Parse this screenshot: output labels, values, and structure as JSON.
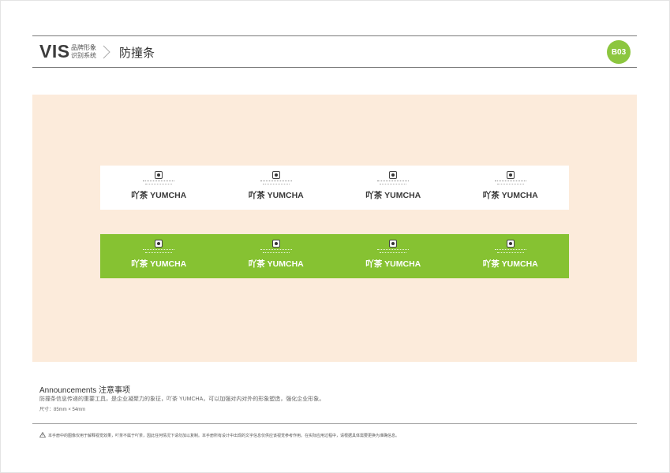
{
  "header": {
    "vis": "VIS",
    "vis_sub_line1": "品牌形象",
    "vis_sub_line2": "识别系统",
    "title": "防撞条",
    "badge": "B03"
  },
  "strips": {
    "white": {
      "background": "#ffffff",
      "logos": [
        {
          "wordmark": "吖茶 YUMCHA"
        },
        {
          "wordmark": "吖茶 YUMCHA"
        },
        {
          "wordmark": "吖茶 YUMCHA"
        },
        {
          "wordmark": "吖茶 YUMCHA"
        }
      ]
    },
    "green": {
      "background": "#86c232",
      "logos": [
        {
          "wordmark": "吖茶 YUMCHA"
        },
        {
          "wordmark": "吖茶 YUMCHA"
        },
        {
          "wordmark": "吖茶 YUMCHA"
        },
        {
          "wordmark": "吖茶 YUMCHA"
        }
      ]
    }
  },
  "announcements": {
    "title": "Announcements  注意事项",
    "body": "防撞条信息传递的重要工具，是企业凝聚力的象征，吖茶 YUMCHA，可以加强对内对外的形象塑造，强化企业形象。",
    "size": "尺寸：85mm × 54mm"
  },
  "footer": {
    "icon": "warning-icon",
    "text": "本手册中的图像仅用于解释视觉效果，吖茶不属于吖茶，因此任何情况下请勿加以复制。本手册所有设计中出现的文字信息仅供应该视觉参考作用。在实际应用过程中，请根据具体需要更换为准确信息。"
  },
  "colors": {
    "accent_green": "#8cc63f",
    "panel_bg": "#fcebdb"
  }
}
